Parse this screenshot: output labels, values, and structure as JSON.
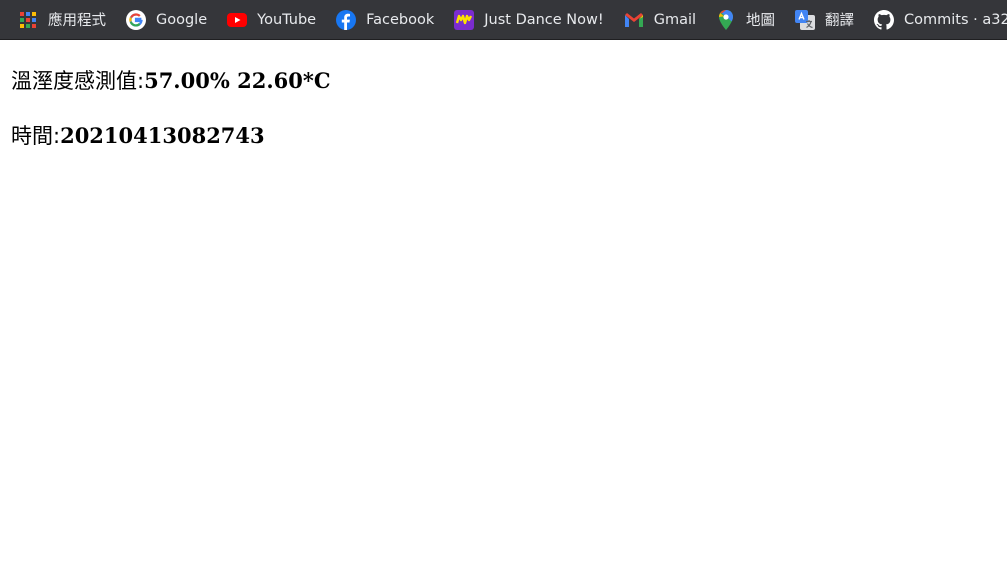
{
  "bookmarks": [
    {
      "label": "應用程式",
      "icon": "apps-grid-icon"
    },
    {
      "label": "Google",
      "icon": "google-icon"
    },
    {
      "label": "YouTube",
      "icon": "youtube-icon"
    },
    {
      "label": "Facebook",
      "icon": "facebook-icon"
    },
    {
      "label": "Just Dance Now!",
      "icon": "just-dance-now-icon"
    },
    {
      "label": "Gmail",
      "icon": "gmail-icon"
    },
    {
      "label": "地圖",
      "icon": "maps-pin-icon"
    },
    {
      "label": "翻譯",
      "icon": "translate-icon"
    },
    {
      "label": "Commits · a32",
      "icon": "github-icon"
    }
  ],
  "sensor": {
    "label": "溫溼度感測值:",
    "value": "57.00% 22.60*C"
  },
  "time": {
    "label": "時間:",
    "value": "20210413082743"
  },
  "colors": {
    "toolbar_bg": "#35363a",
    "toolbar_text": "#e8eaed",
    "page_bg": "#ffffff",
    "text": "#000000"
  }
}
